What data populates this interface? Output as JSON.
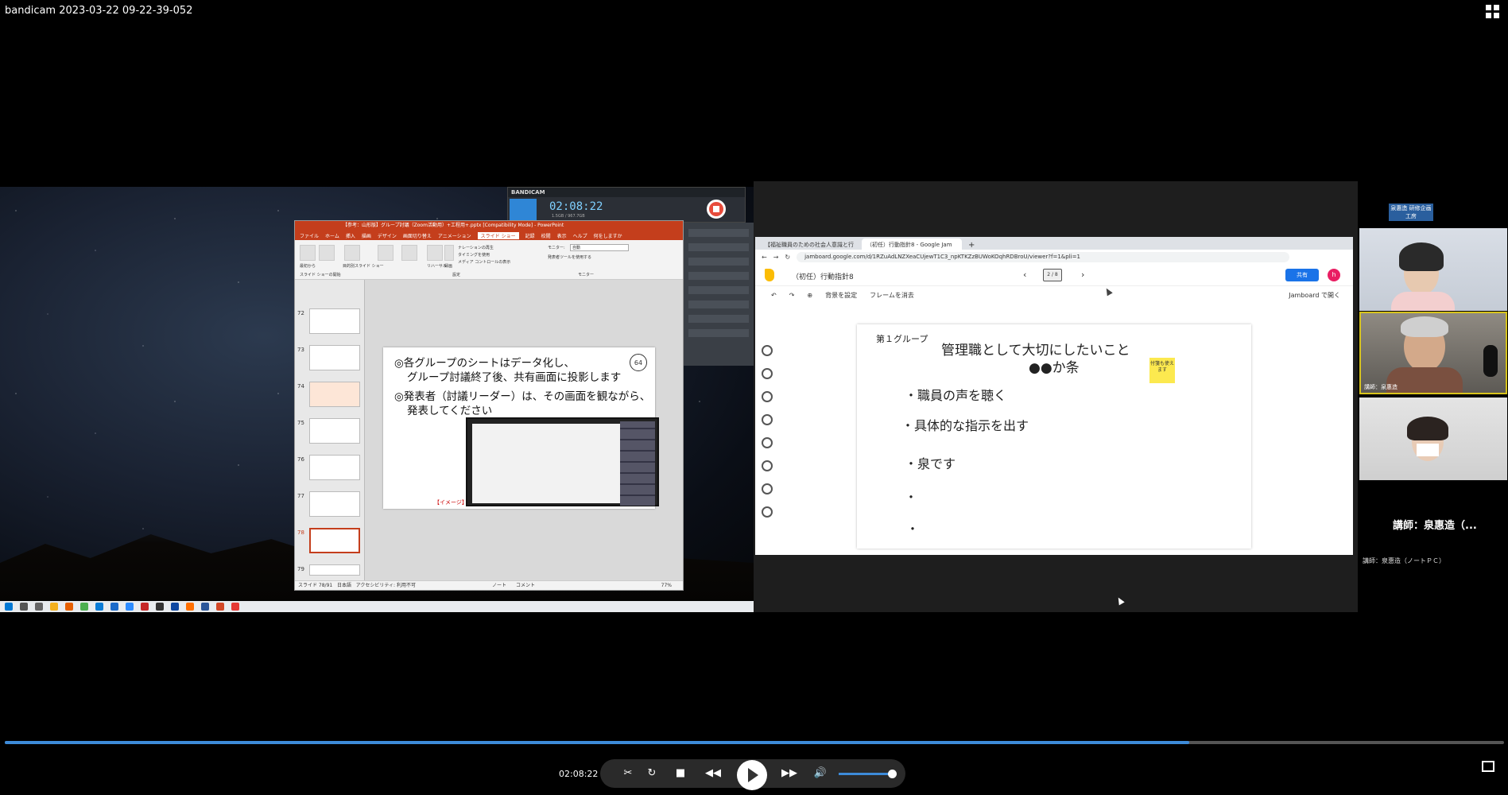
{
  "window": {
    "title": "bandicam 2023-03-22 09-22-39-052"
  },
  "bandicam": {
    "brand": "BANDICAM",
    "time": "02:08:22",
    "size": "1.5GB / 967.7GB"
  },
  "powerpoint": {
    "title": "【参考：山形版】グループ討議（Zoom活動用）+工程用+.pptx [Compatibility Mode] - PowerPoint",
    "tabs": [
      "ファイル",
      "ホーム",
      "挿入",
      "描画",
      "デザイン",
      "画面切り替え",
      "アニメーション",
      "スライド ショー",
      "記録",
      "校閲",
      "表示",
      "ヘルプ",
      "何をしますか"
    ],
    "active_tab": "スライド ショー",
    "ribbon": {
      "from_start": "最初から",
      "from_current": "現在のスライドから",
      "custom": "目的別スライド ショー",
      "setup": "スライド ショーの設定",
      "hide": "非表示スライドに設定",
      "rehearse": "リハーサル",
      "record": "録画",
      "narration": "ナレーションの再生",
      "timings": "タイミングを使用",
      "media": "メディア コントロールの表示",
      "monitor_label": "モニター:",
      "monitor_value": "自動",
      "presenter_view": "発表者ツールを使用する",
      "group_start": "スライド ショーの開始",
      "group_setup": "設定",
      "group_monitor": "モニター"
    },
    "thumbnails": [
      "72",
      "73",
      "74",
      "75",
      "76",
      "77",
      "78",
      "79"
    ],
    "selected_thumbnail": "78",
    "slide": {
      "line1": "◎各グループのシートはデータ化し、",
      "line2": "グループ討議終了後、共有画面に投影します",
      "line3": "◎発表者（討議リーダー）は、その画面を観ながら、",
      "line4": "発表してください",
      "badge": "64",
      "image_label": "【イメージ】"
    },
    "status": {
      "slide": "スライド 78/91",
      "lang": "日本語",
      "access": "アクセシビリティ: 利用不可",
      "notes": "ノート",
      "comments": "コメント",
      "zoom": "77%"
    }
  },
  "browser": {
    "tabs": [
      "【福祉職員のための社会人意識と行",
      "（初任）行動指針8 - Google Jam"
    ],
    "url": "jamboard.google.com/d/1RZuAdLNZXeaCUjewT1C3_npKTKZzBUWoKOqhRDBroU/viewer?f=1&pli=1",
    "jam": {
      "title": "（初任）行動指針8",
      "frame": "2 / 8",
      "share": "共有",
      "avatar": "h",
      "set_bg": "背景を設定",
      "clear": "フレームを消去",
      "open_in": "Jamboard で開く",
      "group": "第１グループ",
      "heading1": "管理職として大切にしたいこと",
      "heading2": "●●か条",
      "bullet1": "・職員の声を聴く",
      "bullet2": "・具体的な指示を出す",
      "bullet3": "・泉です",
      "bullet4": "・",
      "bullet5": "・",
      "sticky": "付箋も使えます"
    }
  },
  "video": {
    "label_top": "泉惠造 研修企画工房",
    "participant2_name": "講師：泉惠造",
    "presenter_big": "講師：泉惠造（...",
    "presenter_small": "講師：泉惠造（ノートＰＣ）"
  },
  "player": {
    "time": "02:08:22",
    "progress_fraction": 0.79
  }
}
